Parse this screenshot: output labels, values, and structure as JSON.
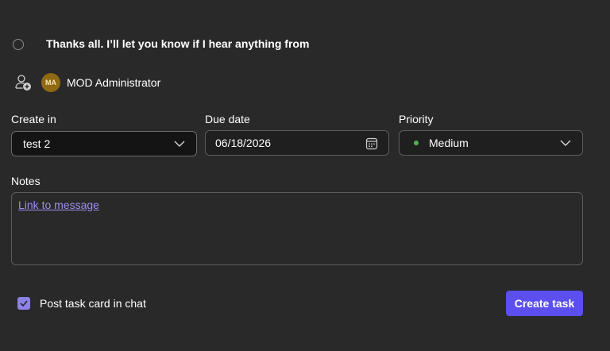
{
  "task": {
    "title": "Thanks all. I’ll let you know if I hear anything from"
  },
  "assignee": {
    "initials": "MA",
    "name": "MOD Administrator",
    "avatar_color": "#8f6a12"
  },
  "fields": {
    "create_in": {
      "label": "Create in",
      "value": "test 2"
    },
    "due_date": {
      "label": "Due date",
      "value": "06/18/2026"
    },
    "priority": {
      "label": "Priority",
      "value": "Medium",
      "dot_color": "#54b054"
    }
  },
  "notes": {
    "label": "Notes",
    "link_text": "Link to message"
  },
  "footer": {
    "post_card_label": "Post task card in chat",
    "post_card_checked": true,
    "create_button_label": "Create task"
  },
  "colors": {
    "background": "#292929",
    "accent": "#5b4ff0",
    "link": "#9c8ff0",
    "checkbox": "#8c82e8"
  },
  "icons": [
    "circle-check-icon",
    "assign-person-icon",
    "chevron-down-icon",
    "calendar-icon",
    "checkmark-icon"
  ]
}
